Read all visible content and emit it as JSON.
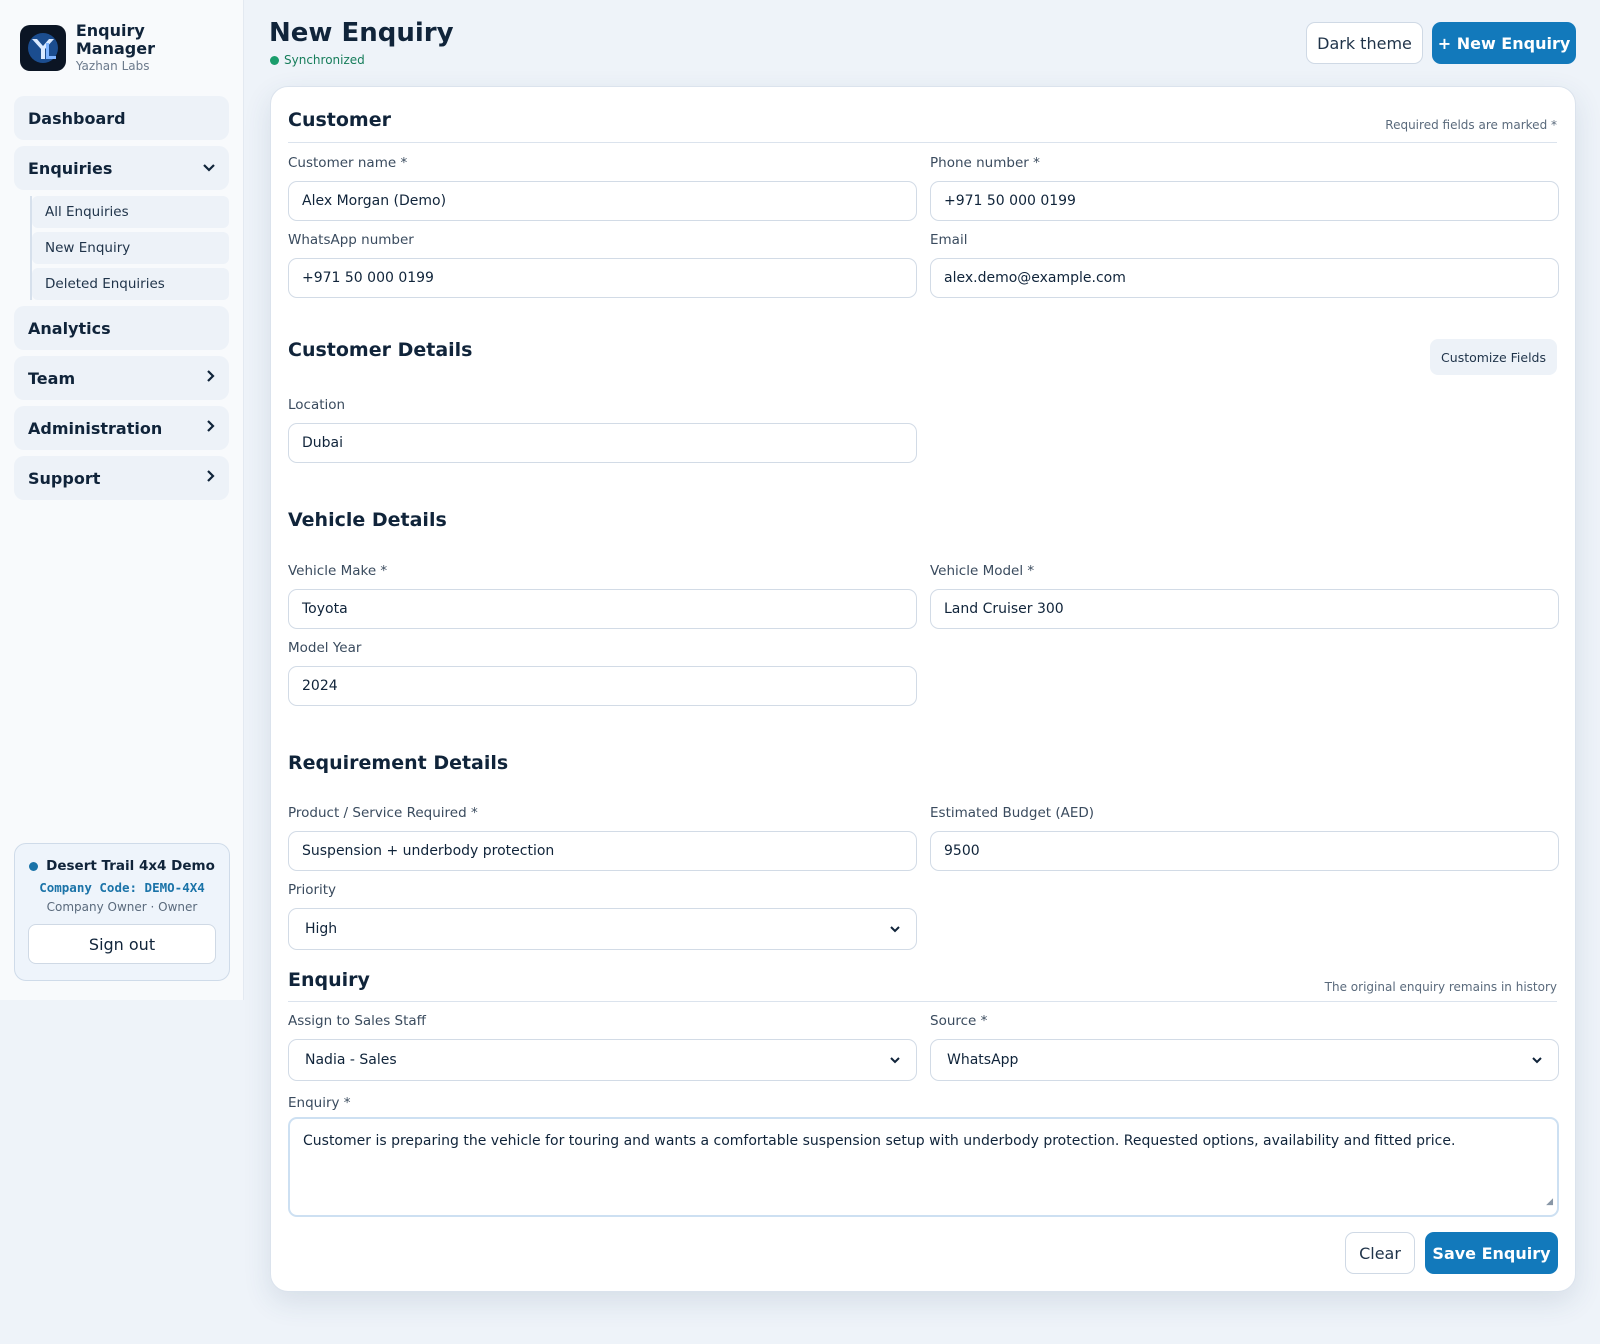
{
  "brand": {
    "name": "Enquiry Manager",
    "sub": "Yazhan Labs"
  },
  "sidebar": {
    "items": [
      {
        "label": "Dashboard"
      },
      {
        "label": "Enquiries",
        "chevron": "⌄"
      },
      {
        "label": "Analytics"
      },
      {
        "label": "Team",
        "chevron": "›"
      },
      {
        "label": "Administration",
        "chevron": "›"
      },
      {
        "label": "Support",
        "chevron": "›"
      }
    ],
    "subitems": [
      {
        "label": "All Enquiries"
      },
      {
        "label": "New Enquiry"
      },
      {
        "label": "Deleted Enquiries"
      }
    ]
  },
  "company": {
    "name": "Desert Trail 4x4 Demo",
    "code": "Company Code: DEMO-4X4",
    "role": "Company Owner · Owner",
    "signout_label": "Sign out"
  },
  "header": {
    "title": "New Enquiry",
    "status": "Synchronized",
    "dark_theme_label": "Dark theme",
    "new_enquiry_label": "+ New Enquiry"
  },
  "form": {
    "customer": {
      "title": "Customer",
      "note": "Required fields are marked *",
      "name_label": "Customer name *",
      "name_value": "Alex Morgan (Demo)",
      "phone_label": "Phone number *",
      "phone_value": "+971 50 000 0199",
      "whatsapp_label": "WhatsApp number",
      "whatsapp_value": "+971 50 000 0199",
      "email_label": "Email",
      "email_value": "alex.demo@example.com"
    },
    "customer_details": {
      "title": "Customer Details",
      "customize_label": "Customize Fields",
      "location_label": "Location",
      "location_value": "Dubai"
    },
    "vehicle": {
      "title": "Vehicle Details",
      "make_label": "Vehicle Make *",
      "make_value": "Toyota",
      "model_label": "Vehicle Model *",
      "model_value": "Land Cruiser 300",
      "year_label": "Model Year",
      "year_value": "2024"
    },
    "requirement": {
      "title": "Requirement Details",
      "product_label": "Product / Service Required *",
      "product_value": "Suspension + underbody protection",
      "budget_label": "Estimated Budget (AED)",
      "budget_value": "9500",
      "priority_label": "Priority",
      "priority_value": "High"
    },
    "enquiry": {
      "title": "Enquiry",
      "note": "The original enquiry remains in history",
      "assign_label": "Assign to Sales Staff",
      "assign_value": "Nadia - Sales",
      "source_label": "Source *",
      "source_value": "WhatsApp",
      "enquiry_label": "Enquiry *",
      "enquiry_value": "Customer is preparing the vehicle for touring and wants a comfortable suspension setup with underbody protection. Requested options, availability and fitted price."
    },
    "actions": {
      "clear_label": "Clear",
      "save_label": "Save Enquiry"
    }
  },
  "colors": {
    "accent": "#1279bb",
    "sync": "#1a9d6c",
    "background": "#eef3f9"
  },
  "icons": {
    "caret": "⌄",
    "resize": "◢"
  }
}
